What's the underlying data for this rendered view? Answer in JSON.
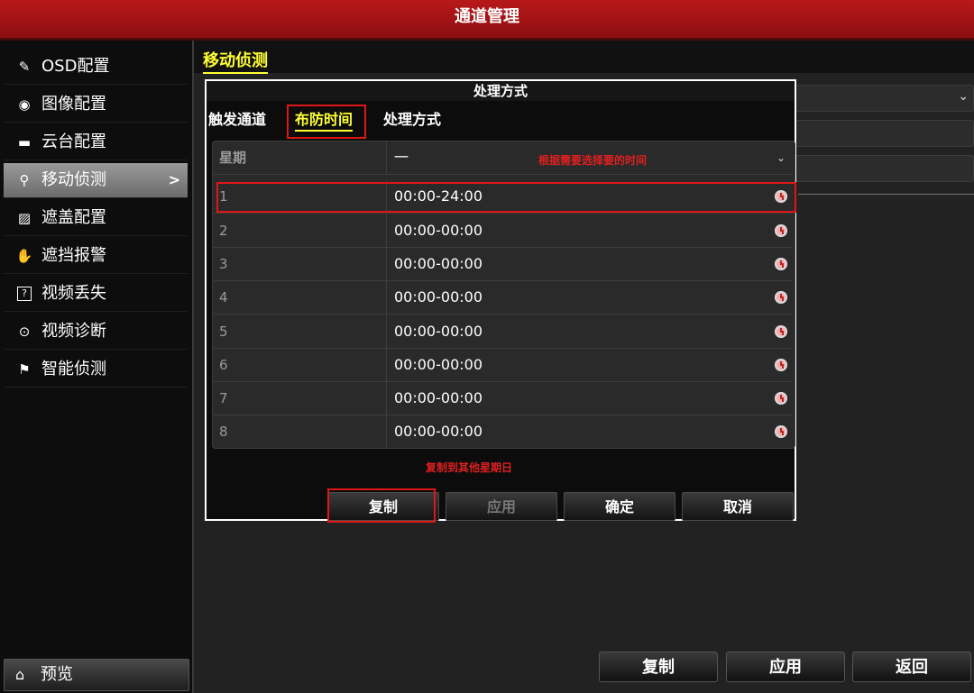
{
  "window": {
    "title": "通道管理"
  },
  "sidebar": {
    "items": [
      {
        "icon": "pen-icon",
        "glyph": "✎",
        "label": "OSD配置"
      },
      {
        "icon": "image-icon",
        "glyph": "◉",
        "label": "图像配置"
      },
      {
        "icon": "ptz-icon",
        "glyph": "▬",
        "label": "云台配置"
      },
      {
        "icon": "motion-icon",
        "glyph": "⚲",
        "label": "移动侦测",
        "active": true
      },
      {
        "icon": "mask-icon",
        "glyph": "▨",
        "label": "遮盖配置"
      },
      {
        "icon": "hand-icon",
        "glyph": "✋",
        "label": "遮挡报警"
      },
      {
        "icon": "video-loss-icon",
        "glyph": "?",
        "label": "视频丢失"
      },
      {
        "icon": "diagnose-icon",
        "glyph": "⊙",
        "label": "视频诊断"
      },
      {
        "icon": "smart-detect-icon",
        "glyph": "⚑",
        "label": "智能侦测"
      }
    ],
    "active_arrow": ">",
    "preview": {
      "icon": "home-icon",
      "glyph": "⌂",
      "label": "预览"
    }
  },
  "main": {
    "section_title": "移动侦测",
    "bg_chevron": "⌄"
  },
  "dialog": {
    "title": "处理方式",
    "tabs": [
      {
        "label": "触发通道"
      },
      {
        "label": "布防时间",
        "active": true
      },
      {
        "label": "处理方式"
      }
    ],
    "weekday_label": "星期",
    "weekday_value": "一",
    "weekday_chevron": "⌄",
    "annotation_select_time": "根据需要选择要的时间",
    "rows": [
      {
        "index": "1",
        "time": "00:00-24:00"
      },
      {
        "index": "2",
        "time": "00:00-00:00"
      },
      {
        "index": "3",
        "time": "00:00-00:00"
      },
      {
        "index": "4",
        "time": "00:00-00:00"
      },
      {
        "index": "5",
        "time": "00:00-00:00"
      },
      {
        "index": "6",
        "time": "00:00-00:00"
      },
      {
        "index": "7",
        "time": "00:00-00:00"
      },
      {
        "index": "8",
        "time": "00:00-00:00"
      }
    ],
    "annotation_copy": "复制到其他星期日",
    "buttons": {
      "copy": "复制",
      "apply": "应用",
      "ok": "确定",
      "cancel": "取消"
    }
  },
  "footer": {
    "copy": "复制",
    "apply": "应用",
    "back": "返回"
  },
  "colors": {
    "title_bar": "#9e1214",
    "highlight": "#ffff33",
    "annotation_red": "#e02020"
  }
}
